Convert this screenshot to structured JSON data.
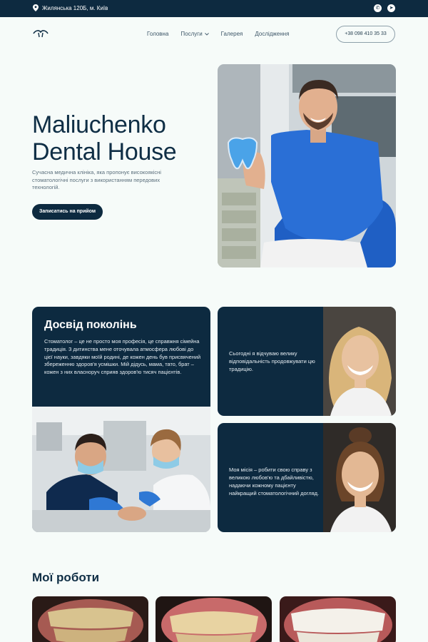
{
  "topbar": {
    "address": "Жилянська 120Б, м. Київ",
    "icons": [
      "map-pin-icon",
      "whatsapp-icon",
      "telegram-icon"
    ]
  },
  "nav": {
    "items": [
      "Головна",
      "Послуги",
      "Галерея",
      "Дослідження"
    ],
    "phone": "+38 098 410 35 33"
  },
  "hero": {
    "title_line1": "Maliuchenko",
    "title_line2": "Dental House",
    "description": "Сучасна медична клініка, яка пропонує високоякісні стоматологічні послуги з використанням передових технологій.",
    "cta": "Записатись на прийом"
  },
  "experience": {
    "title": "Досвід поколінь",
    "text": "Стоматолог – це не просто моя професія, це справжня сімейна традиція. З дитинства мене оточувала атмосфера любові до цієї науки, завдяки моїй родині, де кожен день був присвячений збереженню здоров'я усмішки. Мій дідусь, мама, тато, брат – кожен з них власноруч сприяв здоров'ю тисяч пацієнтів."
  },
  "cards": [
    {
      "text": "Сьогодні я відчуваю велику відповідальність продовжувати цю традицію."
    },
    {
      "text": "Моя місія – робити свою справу з великою любов'ю та дбайливістю, надаючи кожному пацієнту найкращий стоматологічний догляд."
    }
  ],
  "works": {
    "title": "Мої роботи"
  },
  "colors": {
    "navy": "#0d2a40",
    "background": "#f6fbf9",
    "text_muted": "#5b6f7c"
  }
}
